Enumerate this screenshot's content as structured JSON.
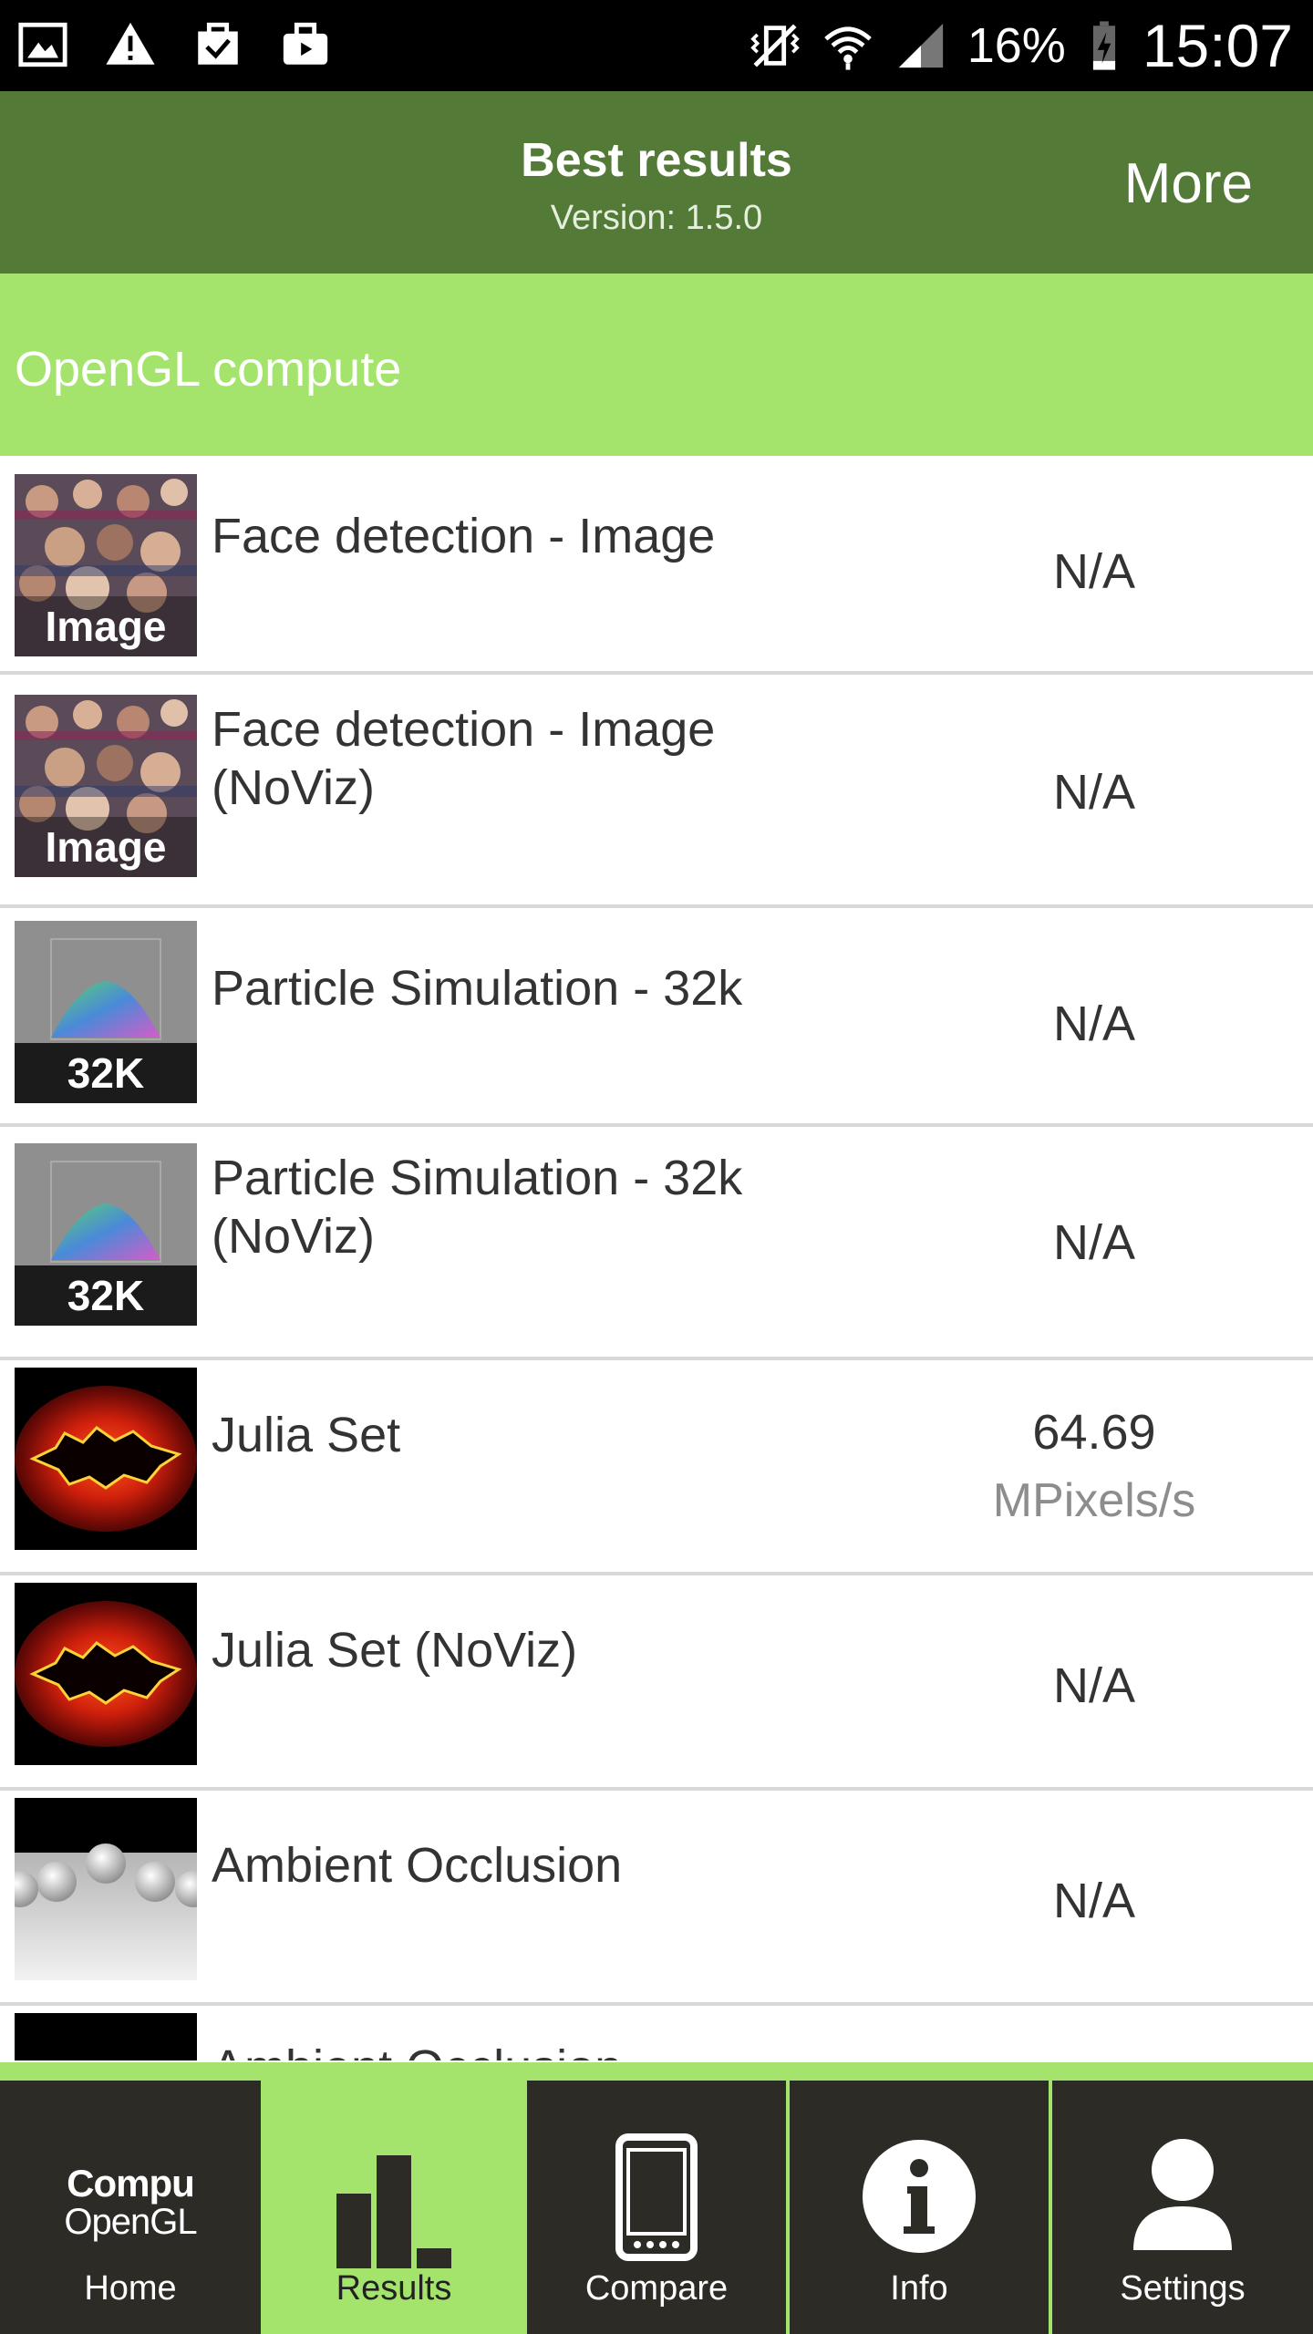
{
  "status_bar": {
    "battery": "16%",
    "time": "15:07",
    "left_icons": [
      "gallery-icon",
      "warning-icon",
      "clipboard-check-icon",
      "briefcase-icon"
    ],
    "right_icons": [
      "vibrate-icon",
      "wifi-icon",
      "signal-icon",
      "battery-charging-icon"
    ]
  },
  "appbar": {
    "title": "Best results",
    "subtitle": "Version: 1.5.0",
    "more_label": "More"
  },
  "section": {
    "title": "OpenGL compute"
  },
  "results": [
    {
      "name": "Face detection - Image",
      "value": "N/A",
      "unit": "",
      "thumb": "crowd",
      "thumb_label": "Image"
    },
    {
      "name": "Face detection - Image (NoViz)",
      "value": "N/A",
      "unit": "",
      "thumb": "crowd",
      "thumb_label": "Image"
    },
    {
      "name": "Particle Simulation - 32k",
      "value": "N/A",
      "unit": "",
      "thumb": "particles",
      "thumb_label": "32K"
    },
    {
      "name": "Particle Simulation - 32k (NoViz)",
      "value": "N/A",
      "unit": "",
      "thumb": "particles",
      "thumb_label": "32K"
    },
    {
      "name": "Julia Set",
      "value": "64.69",
      "unit": "MPixels/s",
      "thumb": "julia",
      "thumb_label": ""
    },
    {
      "name": "Julia Set (NoViz)",
      "value": "N/A",
      "unit": "",
      "thumb": "julia",
      "thumb_label": ""
    },
    {
      "name": "Ambient Occlusion",
      "value": "N/A",
      "unit": "",
      "thumb": "spheres",
      "thumb_label": ""
    },
    {
      "name": "Ambient Occlusion (NoViz)",
      "value": "",
      "unit": "",
      "thumb": "dark",
      "thumb_label": ""
    }
  ],
  "nav": {
    "logo_line1": "Compu",
    "logo_line2": "OpenGL",
    "home": "Home",
    "results": "Results",
    "compare": "Compare",
    "info": "Info",
    "settings": "Settings"
  },
  "colors": {
    "appbar": "#547a37",
    "accent_green": "#a4e46c",
    "nav_dark": "#2d2b26"
  }
}
